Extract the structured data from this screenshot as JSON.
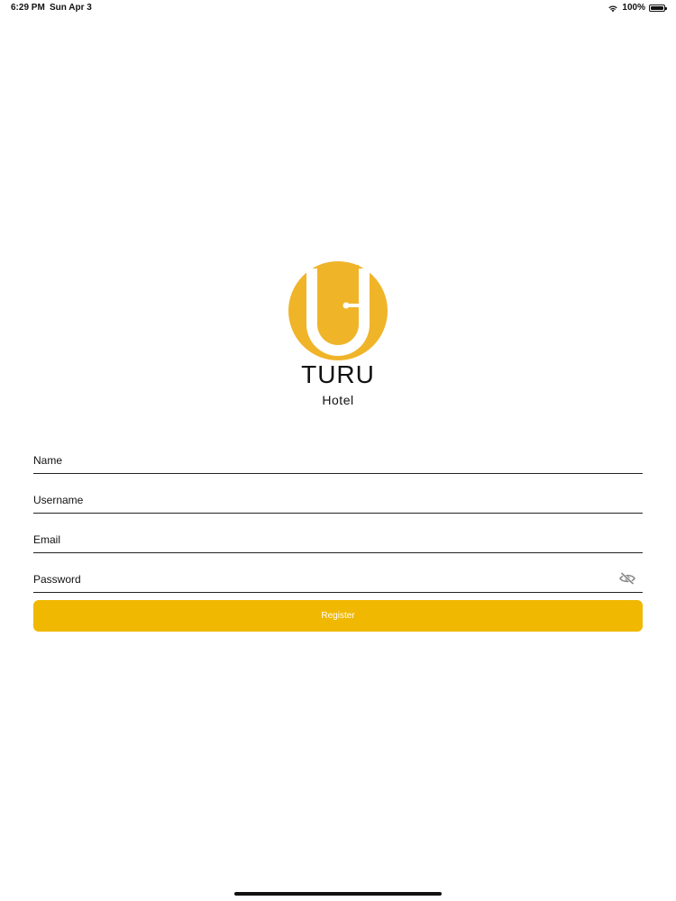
{
  "status_bar": {
    "time": "6:29 PM",
    "date": "Sun Apr 3",
    "battery": "100%",
    "icons": [
      "wifi-icon",
      "battery-icon"
    ]
  },
  "brand": {
    "name": "TURU",
    "subtitle": "Hotel",
    "logo_color": "#f0b429"
  },
  "form": {
    "name_placeholder": "Name",
    "username_placeholder": "Username",
    "email_placeholder": "Email",
    "password_placeholder": "Password",
    "password_toggle_icon": "eye-off-icon",
    "register_label": "Register",
    "accent_color": "#f0b800"
  }
}
